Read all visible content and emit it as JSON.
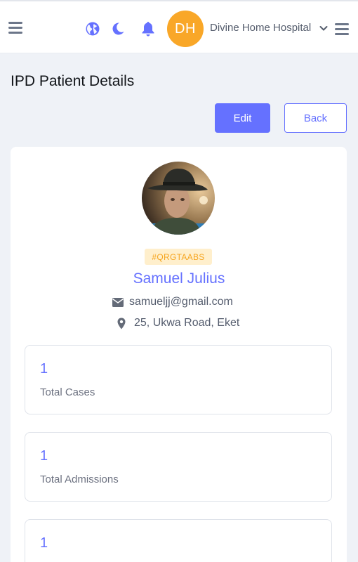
{
  "topbar": {
    "menu_icon": "hamburger-icon",
    "language_icon": "globe-icon",
    "theme_icon": "moon-icon",
    "notification_icon": "bell-icon",
    "user_initials": "DH",
    "hospital_name": "Divine Home Hospital",
    "dropdown_icon": "chevron-down-icon",
    "right_menu_icon": "hamburger-icon"
  },
  "page": {
    "title": "IPD Patient Details",
    "edit_label": "Edit",
    "back_label": "Back"
  },
  "patient": {
    "photo": "patient-photo",
    "unique_id": "#QRGTAABS",
    "name": "Samuel Julius",
    "email_icon": "envelope-icon",
    "email": "samueljj@gmail.com",
    "address_icon": "map-pin-icon",
    "address": "25, Ukwa Road, Eket"
  },
  "stats": [
    {
      "value": "1",
      "label": "Total Cases"
    },
    {
      "value": "1",
      "label": "Total Admissions"
    },
    {
      "value": "1",
      "label": ""
    }
  ],
  "colors": {
    "primary": "#6571ff",
    "avatar": "#f9a728",
    "badge_bg": "#ffefcc",
    "badge_text": "#f6a622",
    "background": "#eff2f7"
  }
}
